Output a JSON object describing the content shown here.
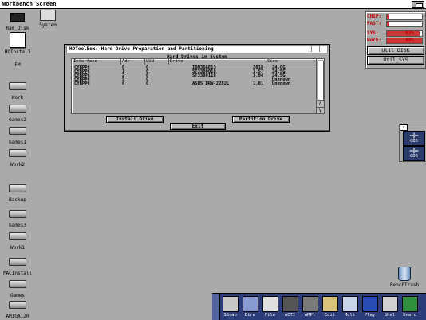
{
  "screen": {
    "title": "Workbench Screen"
  },
  "desktop_icons": [
    {
      "label": "Ram Disk",
      "kind": "chip"
    },
    {
      "label": "System",
      "kind": "computer"
    },
    {
      "label": "HDInstall",
      "kind": "hdinstall"
    },
    {
      "label": "FM",
      "kind": "none"
    },
    {
      "label": "Work",
      "kind": "drive"
    },
    {
      "label": "Games2",
      "kind": "drive"
    },
    {
      "label": "Games1",
      "kind": "drive"
    },
    {
      "label": "Work2",
      "kind": "drive"
    },
    {
      "label": "Backup",
      "kind": "drive"
    },
    {
      "label": "Games3",
      "kind": "drive"
    },
    {
      "label": "Work1",
      "kind": "drive"
    },
    {
      "label": "PACInstall",
      "kind": "drive"
    },
    {
      "label": "Games",
      "kind": "drive"
    },
    {
      "label": "AMIGA120",
      "kind": "drive"
    }
  ],
  "hdtoolbox": {
    "title": "HDToolBox: Hard Drive Preparation and Partitioning",
    "frame_title": "Hard Drives in System",
    "columns": [
      "Interface",
      "Adr",
      "LUN",
      "Drive",
      "Size"
    ],
    "rows": [
      [
        "CYBPPC",
        "0",
        "0",
        "IBM36GE13",
        "2018",
        "24.0G"
      ],
      [
        "CYBPPC",
        "1",
        "0",
        "ST3300018",
        "3.57",
        "24.5G"
      ],
      [
        "CYBPPC",
        "2",
        "0",
        "ST3300118",
        "3.04",
        "24.5G"
      ],
      [
        "CYBPPC",
        "5",
        "0",
        "",
        "",
        "Unknown"
      ],
      [
        "CYBPPC",
        "6",
        "0",
        "ASUS    DRW-2202L",
        "1.01",
        "Unknown"
      ]
    ],
    "scroll_up": "Λ",
    "scroll_down": "V",
    "buttons": {
      "install": "Install Drive",
      "partition": "Partition Drive",
      "exit": "Exit"
    }
  },
  "monitor": {
    "chip_label": "CHIP:",
    "fast_label": "FAST:",
    "sys_label": "SYS:",
    "sys_value": "93%",
    "sys_fill": 0.93,
    "work_label": "Work:",
    "work_value": "99%",
    "work_fill": 0.99,
    "util_disk": "Util_DISK",
    "util_sys": "Util_SYS"
  },
  "cd_panel": {
    "mini": "x",
    "cd5": "CD5",
    "cd6": "CD6"
  },
  "trash": {
    "label": "BenchTrash"
  },
  "dock": {
    "items": [
      "SGrab",
      "Dire",
      "File",
      "ACTI",
      "AMPl",
      "Edit",
      "Mult",
      "Play",
      "Shel",
      "Unarc"
    ],
    "colors": [
      "#c8c8c8",
      "#8a9bd1",
      "#e0e0e0",
      "#555555",
      "#7a7a7a",
      "#d9c37a",
      "#c9d4e8",
      "#2a4cb5",
      "#d0d0d0",
      "#2f8f3a"
    ]
  }
}
